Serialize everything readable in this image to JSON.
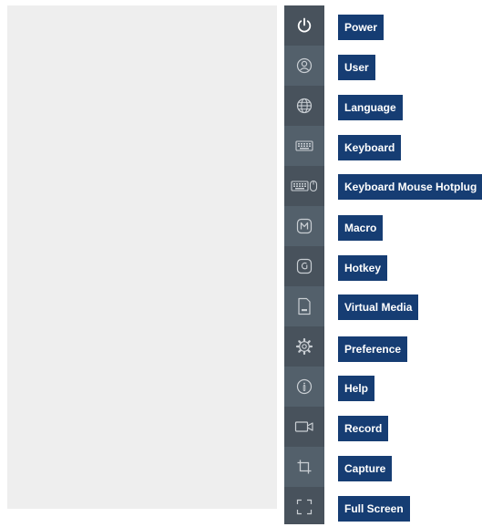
{
  "toolbar": {
    "items": [
      {
        "label": "Power",
        "icon": "power-icon"
      },
      {
        "label": "User",
        "icon": "user-icon"
      },
      {
        "label": "Language",
        "icon": "globe-icon"
      },
      {
        "label": "Keyboard",
        "icon": "keyboard-icon"
      },
      {
        "label": "Keyboard Mouse Hotplug",
        "icon": "keyboard-mouse-icon"
      },
      {
        "label": "Macro",
        "icon": "macro-icon"
      },
      {
        "label": "Hotkey",
        "icon": "hotkey-icon"
      },
      {
        "label": "Virtual Media",
        "icon": "file-icon"
      },
      {
        "label": "Preference",
        "icon": "gear-icon"
      },
      {
        "label": "Help",
        "icon": "help-icon"
      },
      {
        "label": "Record",
        "icon": "video-camera-icon"
      },
      {
        "label": "Capture",
        "icon": "crop-icon"
      },
      {
        "label": "Full Screen",
        "icon": "fullscreen-icon"
      }
    ]
  },
  "colors": {
    "toolbar_bg": "#48525c",
    "label_bg": "#163d73",
    "label_text": "#ffffff",
    "canvas_bg": "#eeeeee"
  }
}
